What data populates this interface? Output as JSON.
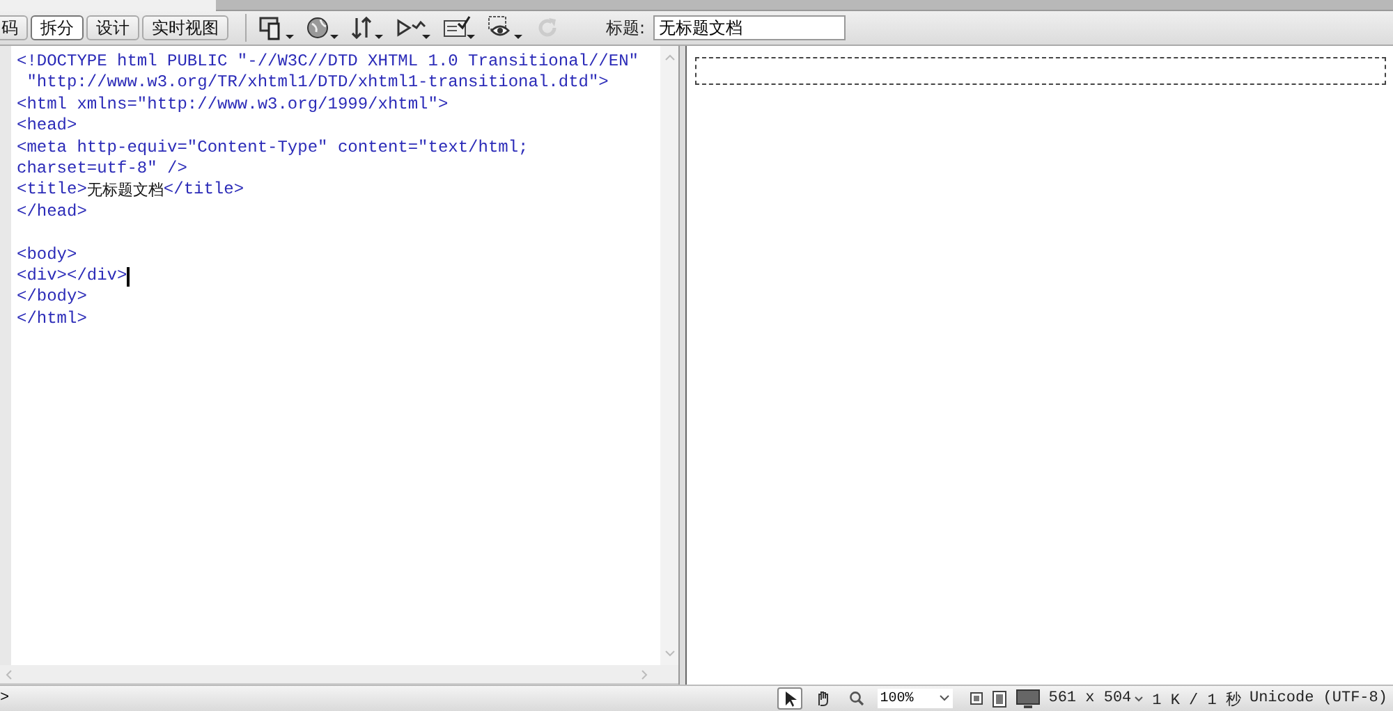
{
  "toolbar": {
    "view_tabs": [
      {
        "label": "码",
        "selected": false
      },
      {
        "label": "拆分",
        "selected": true
      },
      {
        "label": "设计",
        "selected": false
      },
      {
        "label": "实时视图",
        "selected": false
      }
    ],
    "title_label": "标题:",
    "title_value": "无标题文档"
  },
  "code": {
    "lines": [
      {
        "cursor": false,
        "segments": [
          {
            "kind": "tag",
            "text": "<!DOCTYPE html PUBLIC \"-//W3C//DTD XHTML 1.0 Transitional//EN\""
          }
        ]
      },
      {
        "cursor": false,
        "segments": [
          {
            "kind": "tag",
            "text": " \"http://www.w3.org/TR/xhtml1/DTD/xhtml1-transitional.dtd\">"
          }
        ]
      },
      {
        "cursor": false,
        "segments": [
          {
            "kind": "tag",
            "text": "<html xmlns=\"http://www.w3.org/1999/xhtml\">"
          }
        ]
      },
      {
        "cursor": false,
        "segments": [
          {
            "kind": "tag",
            "text": "<head>"
          }
        ]
      },
      {
        "cursor": false,
        "segments": [
          {
            "kind": "tag",
            "text": "<meta http-equiv=\"Content-Type\" content=\"text/html;"
          }
        ]
      },
      {
        "cursor": false,
        "segments": [
          {
            "kind": "tag",
            "text": "charset=utf-8\" />"
          }
        ]
      },
      {
        "cursor": false,
        "segments": [
          {
            "kind": "tag",
            "text": "<title>"
          },
          {
            "kind": "text",
            "text": "无标题文档"
          },
          {
            "kind": "tag",
            "text": "</title>"
          }
        ]
      },
      {
        "cursor": false,
        "segments": [
          {
            "kind": "tag",
            "text": "</head>"
          }
        ]
      },
      {
        "cursor": false
      },
      {
        "cursor": false,
        "segments": [
          {
            "kind": "tag",
            "text": "<body>"
          }
        ]
      },
      {
        "cursor": true,
        "segments": [
          {
            "kind": "tag",
            "text": "<div></div>"
          }
        ]
      },
      {
        "cursor": false,
        "segments": [
          {
            "kind": "tag",
            "text": "</body>"
          }
        ]
      },
      {
        "cursor": false,
        "segments": [
          {
            "kind": "tag",
            "text": "</html>"
          }
        ]
      }
    ]
  },
  "status_bar": {
    "tag_path": ">",
    "tools": [
      {
        "kind": "pointer",
        "selected": true
      },
      {
        "kind": "hand",
        "selected": false
      },
      {
        "kind": "zoom",
        "selected": false
      }
    ],
    "zoom": "100%",
    "size": "561 x 504",
    "download": "1 K / 1 秒",
    "encoding": "Unicode (UTF-8)"
  }
}
